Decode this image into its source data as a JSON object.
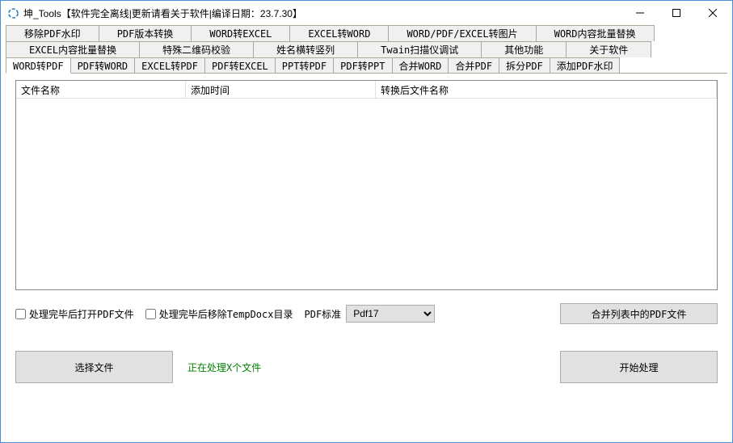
{
  "window": {
    "title": "坤_Tools【软件完全离线|更新请看关于软件|编译日期：23.7.30】"
  },
  "main_tabs_row1": [
    "移除PDF水印",
    "PDF版本转换",
    "WORD转EXCEL",
    "EXCEL转WORD",
    "WORD/PDF/EXCEL转图片",
    "WORD内容批量替换"
  ],
  "main_tabs_row2": [
    "EXCEL内容批量替换",
    "特殊二维码校验",
    "姓名横转竖列",
    "Twain扫描仪调试",
    "其他功能",
    "关于软件"
  ],
  "sub_tabs": [
    "WORD转PDF",
    "PDF转WORD",
    "EXCEL转PDF",
    "PDF转EXCEL",
    "PPT转PDF",
    "PDF转PPT",
    "合并WORD",
    "合并PDF",
    "拆分PDF",
    "添加PDF水印"
  ],
  "active_sub_tab": "WORD转PDF",
  "table": {
    "col1": "文件名称",
    "col2": "添加时间",
    "col3": "转换后文件名称"
  },
  "checkbox1": "处理完毕后打开PDF文件",
  "checkbox2": "处理完毕后移除TempDocx目录",
  "pdf_standard_label": "PDF标准",
  "pdf_standard_value": "Pdf17",
  "btn_merge": "合并列表中的PDF文件",
  "btn_select": "选择文件",
  "status_text": "正在处理X个文件",
  "btn_start": "开始处理"
}
